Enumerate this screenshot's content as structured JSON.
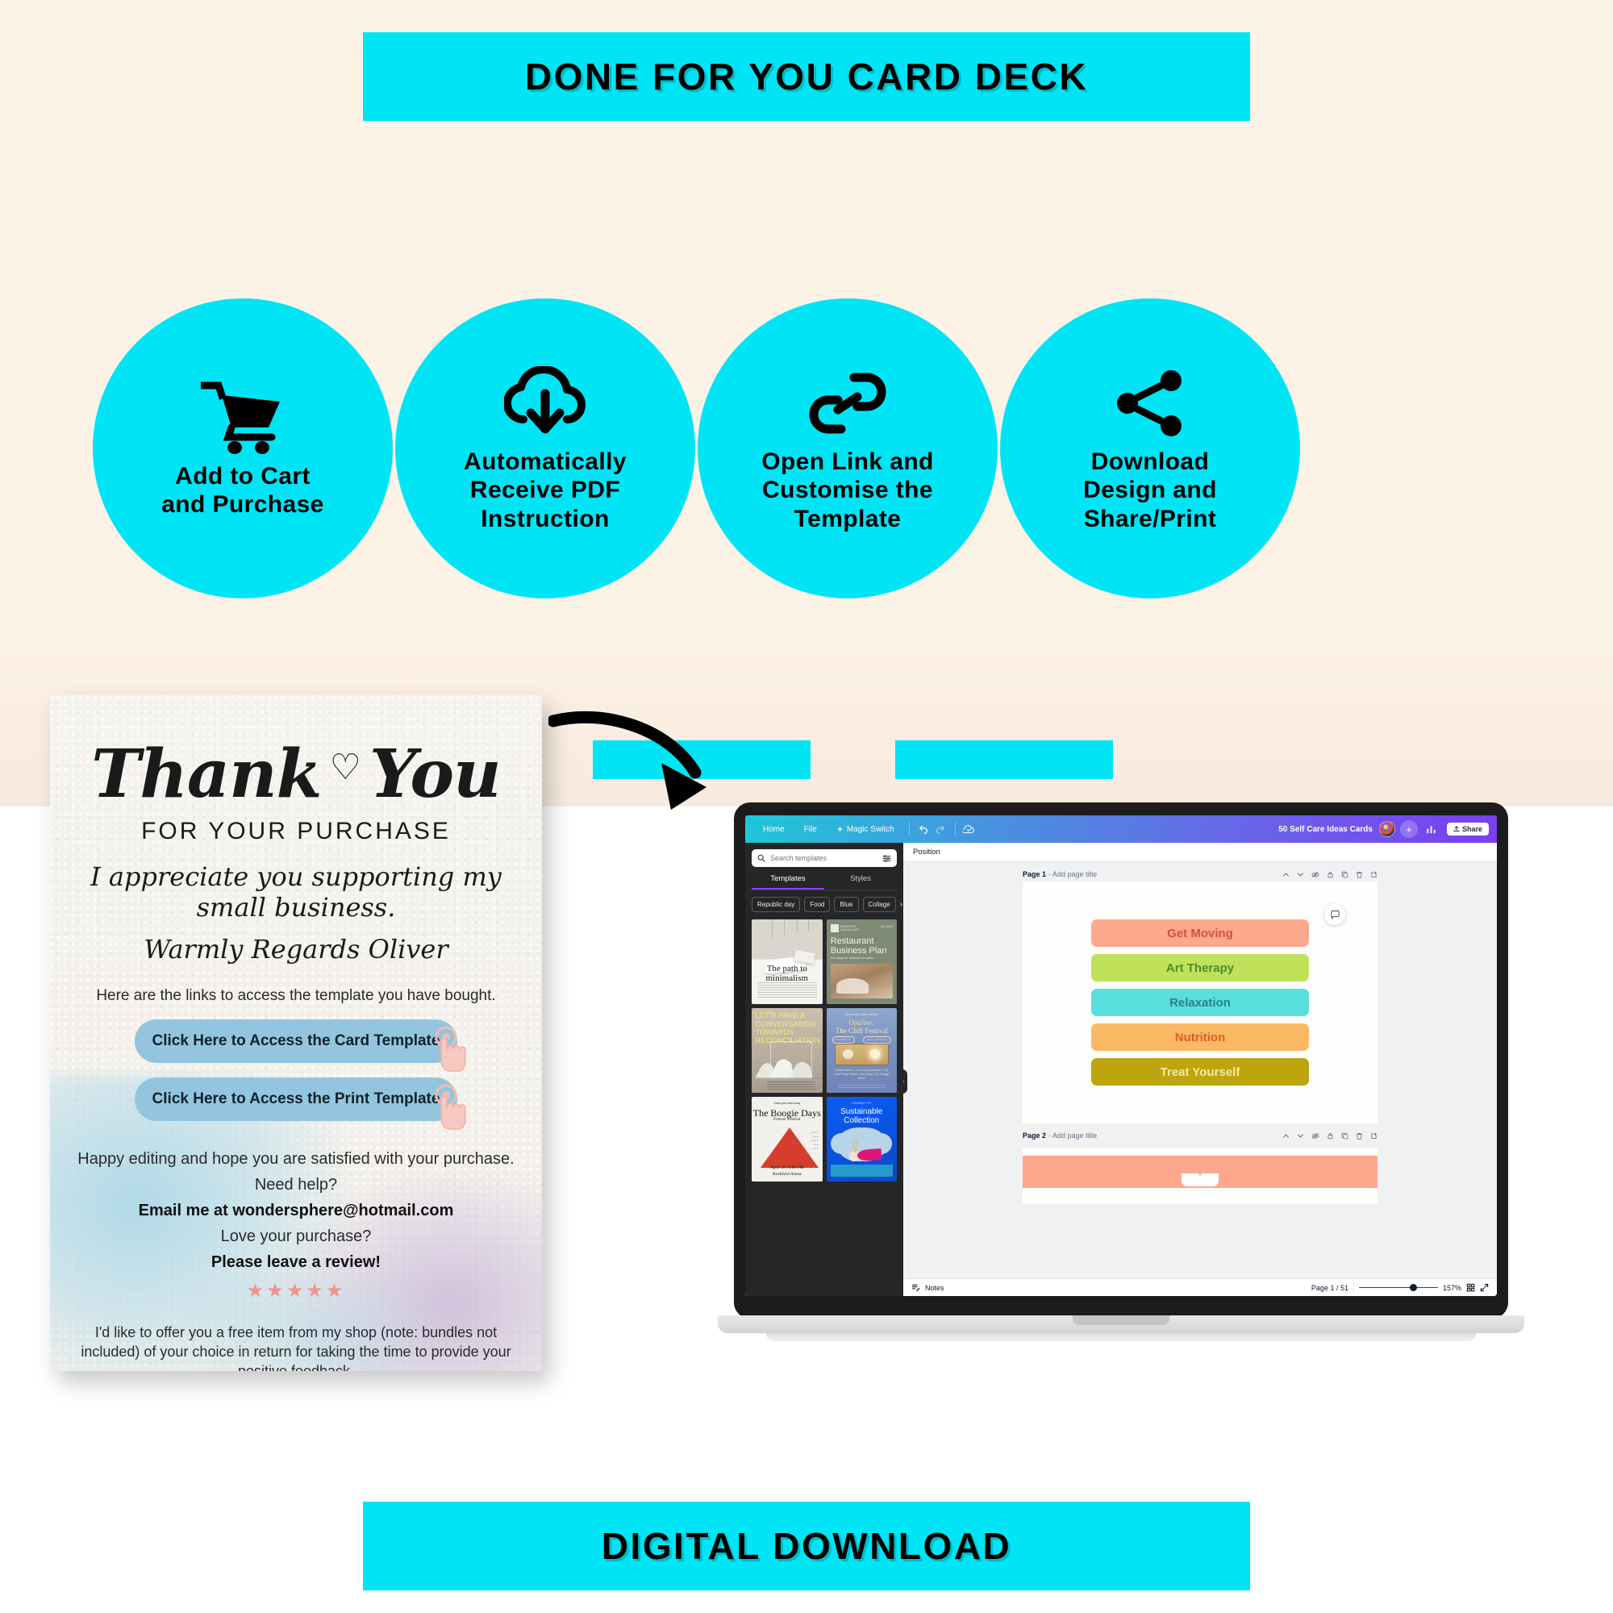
{
  "banners": {
    "top": "DONE FOR YOU CARD DECK",
    "bottom": "DIGITAL DOWNLOAD",
    "accent_color": "#00e5f5"
  },
  "steps": [
    {
      "icon": "shopping-cart-icon",
      "label": "Add to Cart\nand Purchase"
    },
    {
      "icon": "cloud-download-icon",
      "label": "Automatically\nReceive PDF\nInstruction"
    },
    {
      "icon": "link-chain-icon",
      "label": "Open Link and\nCustomise the\nTemplate"
    },
    {
      "icon": "share-nodes-icon",
      "label": "Download\nDesign and\nShare/Print"
    }
  ],
  "thank_you_card": {
    "headline": "Thank",
    "headline_2": "You",
    "heart": "♡",
    "subhead": "FOR YOUR PURCHASE",
    "script_line_1": "I appreciate you supporting my small business.",
    "script_line_2": "Warmly Regards Oliver",
    "links_intro": "Here are the links to access the template you have bought.",
    "buttons": [
      "Click Here to Access the Card Template",
      "Click Here to Access the Print Template"
    ],
    "body": [
      "Happy editing and hope you are satisfied with your purchase.",
      "Need help?"
    ],
    "email_line": "Email me at wondersphere@hotmail.com",
    "love_line": "Love your purchase?",
    "review_line": "Please leave a review!",
    "stars": "★★★★★",
    "closing": "I'd like to offer you a free item from my shop (note: bundles not included) of your choice in return for taking the time to provide your positive feedback.",
    "button_color": "#93c6de",
    "star_color": "#f0948c"
  },
  "canva": {
    "topbar": {
      "home": "Home",
      "file": "File",
      "magic_switch": "Magic Switch",
      "undo_icon": "undo-icon",
      "redo_icon": "redo-icon",
      "cloud_icon": "cloud-saved-icon",
      "doc_title": "50 Self Care Ideas Cards",
      "plus": "+",
      "insights_icon": "insights-chart-icon",
      "share_label": "Share"
    },
    "sidebar": {
      "search_placeholder": "Search templates",
      "filter_icon": "filter-sliders-icon",
      "tabs": [
        {
          "label": "Templates",
          "active": true
        },
        {
          "label": "Styles",
          "active": false
        }
      ],
      "chips": [
        "Republic day",
        "Food",
        "Blue",
        "Collage"
      ],
      "chip_more": "›",
      "templates": [
        {
          "name": "minimalism-template",
          "title": "The path to",
          "title2": "minimalism"
        },
        {
          "name": "restaurant-business-plan-template",
          "brand": "MODERATE\nITALIAN CAFE",
          "date": "03 | 2025",
          "title": "Restaurant",
          "title2": "Business Plan",
          "sub": "Elevating the standard for cafes"
        },
        {
          "name": "reconciliation-template",
          "title": "LET'S HAVE A CONVERSATION TOWARDS RECONCILIATION."
        },
        {
          "name": "chill-festival-template",
          "pre": "Get ready to jazz with us!",
          "title": "Opaline:",
          "title2": "The Chill Festival",
          "pill1": "November 24",
          "pill2": "Encore with Space",
          "lineup": "Funka Rockers | The Long Champions | The Lone Phone Bands | Only Molly | The Orange Knots"
        },
        {
          "name": "boogie-days-template",
          "pre": "I bless your dress sway.",
          "title": "The Boogie Days",
          "sub": "Forever Festival",
          "foot": "April 10  |  6:00 PM\nRockford Arena"
        },
        {
          "name": "sustainable-collection-template",
          "brand": "CROWDFITS",
          "title": "Sustainable",
          "title2": "Collection"
        }
      ]
    },
    "toolbar": {
      "position_label": "Position"
    },
    "canvas": {
      "page1": {
        "label": "Page 1",
        "title_placeholder": "- Add page title"
      },
      "page2": {
        "label": "Page 2",
        "title_placeholder": "- Add page title"
      },
      "page_tools": [
        "move-up-icon",
        "move-down-icon",
        "hide-page-icon",
        "lock-page-icon",
        "duplicate-page-icon",
        "delete-page-icon",
        "add-page-icon"
      ],
      "comment_icon": "comment-bubble-icon",
      "cards": [
        {
          "label": "Get Moving",
          "bg": "#fba88c",
          "fg": "#d6503a"
        },
        {
          "label": "Art Therapy",
          "bg": "#bfe25a",
          "fg": "#4f8c2c"
        },
        {
          "label": "Relaxation",
          "bg": "#59dede",
          "fg": "#2d7f85"
        },
        {
          "label": "Nutrition",
          "bg": "#fbb862",
          "fg": "#e05b28"
        },
        {
          "label": "Treat Yourself",
          "bg": "#bda50e",
          "fg": "#f5e9a0"
        }
      ]
    },
    "statusbar": {
      "notes_icon": "notes-icon",
      "notes_label": "Notes",
      "page_counter": "Page 1 / 51",
      "zoom_level": "157%",
      "grid_icon": "grid-view-icon",
      "fullscreen_icon": "fullscreen-icon"
    }
  }
}
